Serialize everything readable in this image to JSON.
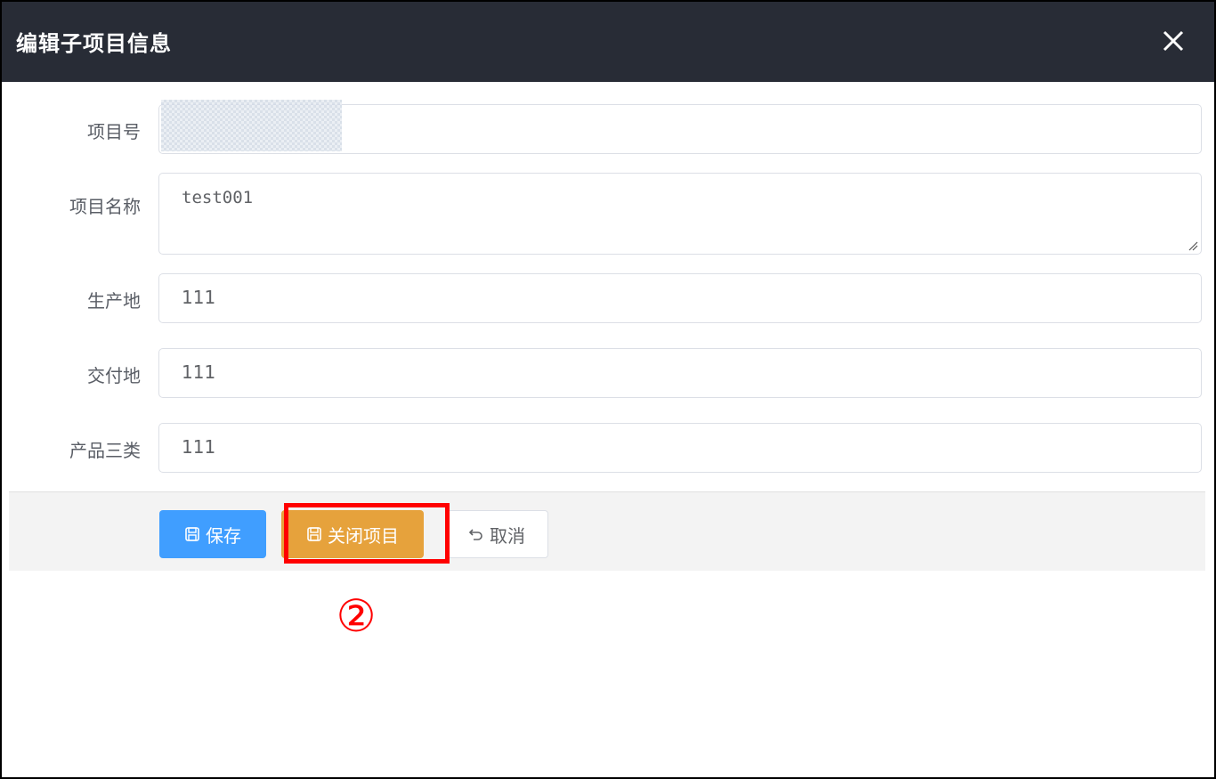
{
  "dialog": {
    "title": "编辑子项目信息",
    "close_icon": "close-icon"
  },
  "form": {
    "project_no": {
      "label": "项目号",
      "value": ""
    },
    "project_name": {
      "label": "项目名称",
      "value": "test001"
    },
    "production_place": {
      "label": "生产地",
      "value": "111"
    },
    "delivery_place": {
      "label": "交付地",
      "value": "111"
    },
    "product_category": {
      "label": "产品三类",
      "value": "111"
    }
  },
  "footer": {
    "save_label": "保存",
    "close_project_label": "关闭项目",
    "cancel_label": "取消"
  },
  "annotation": {
    "marker": "②",
    "color": "#ff0000"
  },
  "colors": {
    "header_bg": "#282c36",
    "primary": "#409eff",
    "warning": "#e6a23c"
  }
}
